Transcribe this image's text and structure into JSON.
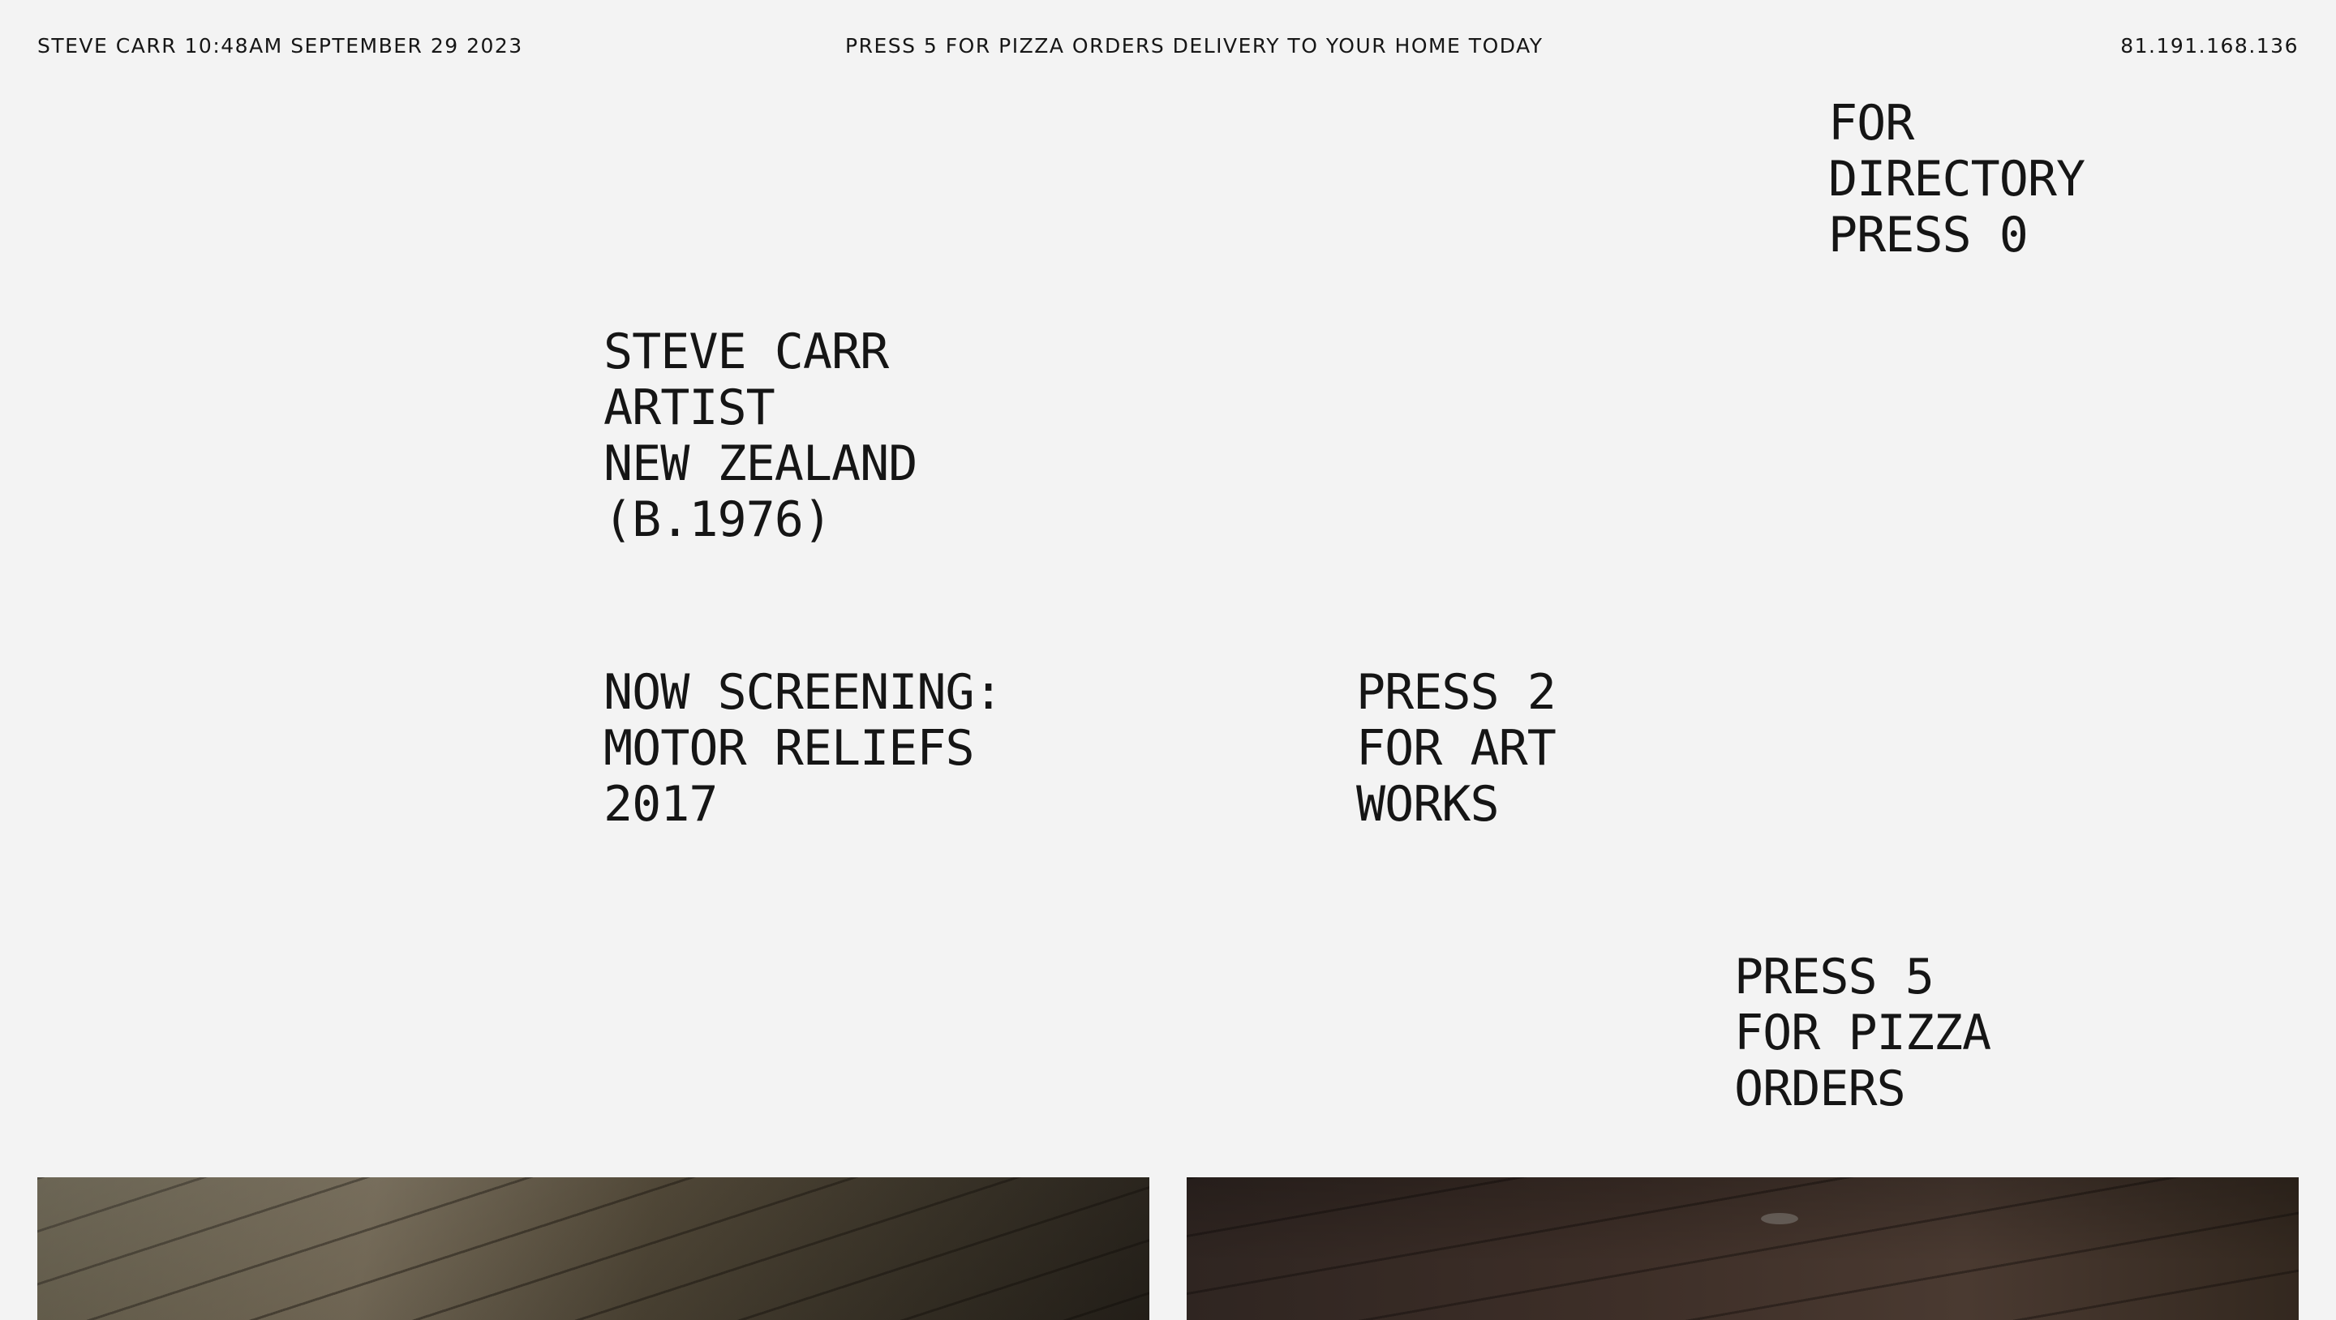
{
  "topbar": {
    "left_text": "STEVE CARR 10:48AM SEPTEMBER 29 2023",
    "center_text": "PRESS 5 FOR PIZZA ORDERS DELIVERY TO YOUR HOME TODAY",
    "right_text": "81.191.168.136"
  },
  "artist": {
    "name": "STEVE CARR",
    "role": "ARTIST",
    "country": "NEW ZEALAND",
    "born": "(B.1976)"
  },
  "screening": {
    "label": "NOW SCREENING:",
    "title": "MOTOR RELIEFS",
    "year": "2017"
  },
  "menu": {
    "directory": [
      "FOR",
      "DIRECTORY",
      "PRESS 0"
    ],
    "artworks": [
      "PRESS 2",
      "FOR ART",
      "WORKS"
    ],
    "pizza": [
      "PRESS 5",
      "FOR PIZZA",
      "ORDERS"
    ]
  },
  "colors": {
    "background": "#f3f3f3",
    "text": "#151515"
  }
}
